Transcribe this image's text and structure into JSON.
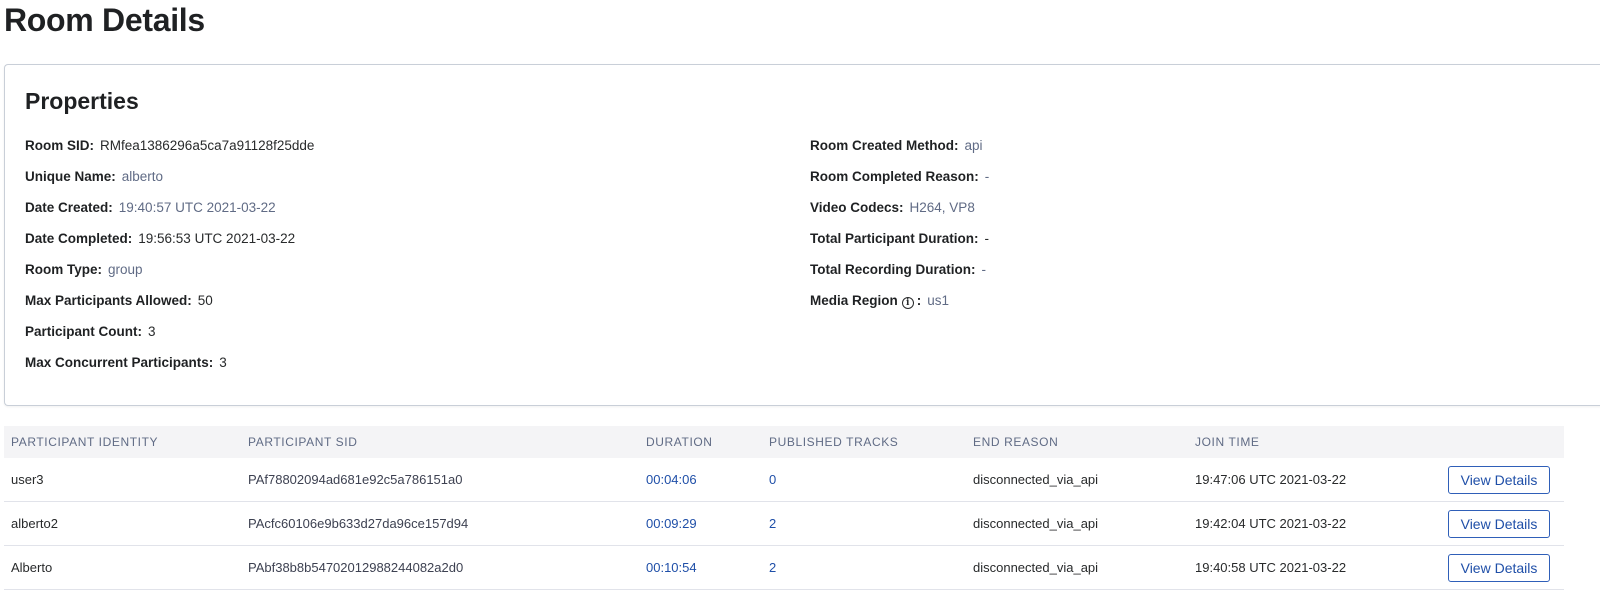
{
  "page": {
    "title": "Room Details"
  },
  "properties": {
    "title": "Properties",
    "left": [
      {
        "label": "Room SID:",
        "value": "RMfea1386296a5ca7a91128f25dde"
      },
      {
        "label": "Unique Name:",
        "value": "alberto"
      },
      {
        "label": "Date Created:",
        "value": "19:40:57 UTC 2021-03-22"
      },
      {
        "label": "Date Completed:",
        "value": "19:56:53 UTC 2021-03-22"
      },
      {
        "label": "Room Type:",
        "value": "group"
      },
      {
        "label": "Max Participants Allowed:",
        "value": "50"
      },
      {
        "label": "Participant Count:",
        "value": "3"
      },
      {
        "label": "Max Concurrent Participants:",
        "value": "3"
      }
    ],
    "right": [
      {
        "label": "Room Created Method:",
        "value": "api"
      },
      {
        "label": "Room Completed Reason:",
        "value": "-"
      },
      {
        "label": "Video Codecs:",
        "value": "H264, VP8"
      },
      {
        "label": "Total Participant Duration:",
        "value": "-"
      },
      {
        "label": "Total Recording Duration:",
        "value": "-"
      },
      {
        "label": "Media Region",
        "info_icon": "info-circle-icon",
        "separator": ":",
        "value": "us1"
      }
    ]
  },
  "table": {
    "columns": [
      "PARTICIPANT IDENTITY",
      "PARTICIPANT SID",
      "DURATION",
      "PUBLISHED TRACKS",
      "END REASON",
      "JOIN TIME"
    ],
    "rows": [
      {
        "identity": "user3",
        "sid": "PAf78802094ad681e92c5a786151a0",
        "duration": "00:04:06",
        "tracks": "0",
        "end_reason": "disconnected_via_api",
        "join_time": "19:47:06 UTC 2021-03-22",
        "action": "View Details"
      },
      {
        "identity": "alberto2",
        "sid": "PAcfc60106e9b633d27da96ce157d94",
        "duration": "00:09:29",
        "tracks": "2",
        "end_reason": "disconnected_via_api",
        "join_time": "19:42:04 UTC 2021-03-22",
        "action": "View Details"
      },
      {
        "identity": "Alberto",
        "sid": "PAbf38b8b54702012988244082a2d0",
        "duration": "00:10:54",
        "tracks": "2",
        "end_reason": "disconnected_via_api",
        "join_time": "19:40:58 UTC 2021-03-22",
        "action": "View Details"
      }
    ]
  },
  "colors": {
    "link": "#1f4fa8",
    "header_bg": "#f4f4f6",
    "muted": "#606b85"
  }
}
